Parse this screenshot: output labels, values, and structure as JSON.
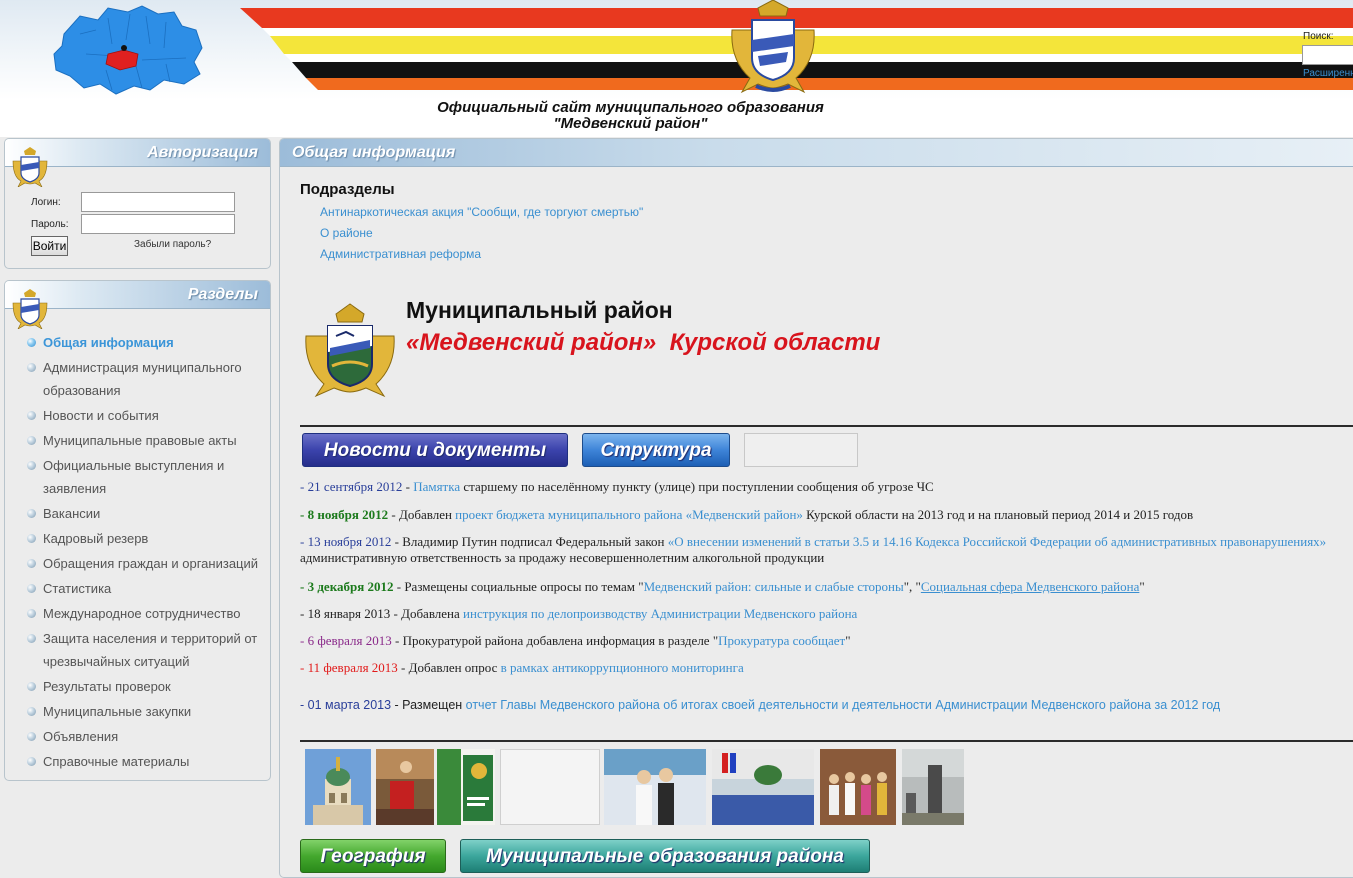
{
  "header": {
    "title_line1": "Официальный сайт муниципального образования",
    "title_line2": "\"Медвенский район\"",
    "search_label": "Поиск:",
    "search_value": "",
    "advanced_search_label": "Расширенный поиск",
    "flag_colors": [
      "#e8391f",
      "#f4e53a",
      "#111111",
      "#f06a1e"
    ]
  },
  "auth": {
    "title": "Авторизация",
    "login_label": "Логин:",
    "login_value": "",
    "password_label": "Пароль:",
    "password_value": "",
    "submit_label": "Войти",
    "forgot_label": "Забыли пароль?"
  },
  "sections": {
    "title": "Разделы",
    "items": [
      {
        "label": "Общая информация",
        "active": true
      },
      {
        "label": "Администрация муниципального образования"
      },
      {
        "label": "Новости и события"
      },
      {
        "label": "Муниципальные правовые акты"
      },
      {
        "label": "Официальные выступления и заявления"
      },
      {
        "label": "Вакансии"
      },
      {
        "label": "Кадровый резерв"
      },
      {
        "label": "Обращения граждан и организаций"
      },
      {
        "label": "Статистика"
      },
      {
        "label": "Международное сотрудничество"
      },
      {
        "label": "Защита населения и территорий от чрезвычайных ситуаций"
      },
      {
        "label": "Результаты проверок"
      },
      {
        "label": "Муниципальные закупки"
      },
      {
        "label": "Объявления"
      },
      {
        "label": "Справочные материалы"
      }
    ]
  },
  "main": {
    "title": "Общая информация",
    "subsections_title": "Подразделы",
    "subsections": [
      "Антинаркотическая акция \"Сообщи, где торгуют смертью\"",
      "О районе",
      "Административная реформа"
    ],
    "district_title": "Муниципальный район",
    "district_subtitle": "«Медвенский район»  Курской области",
    "tabs": {
      "news": "Новости и документы",
      "structure": "Структура"
    },
    "news": [
      {
        "date": "21 сентября 2012",
        "link": "Памятка",
        "text": " старшему по населённому пункту (улице) при поступлении сообщения об угрозе ЧС"
      },
      {
        "date": "8 ноября 2012",
        "text1": " Добавлен ",
        "link": "проект бюджета муниципального района «Медвенский район»",
        "text2": " Курской области  на 2013 год и на плановый период 2014 и 2015 годов"
      },
      {
        "date": "13 ноября 2012",
        "text1": " - Владимир Путин подписал Федеральный закон ",
        "link": "«О внесении изменений в статьи 3.5 и 14.16 Кодекса Российской Федерации об административных правонарушениях»",
        "line2": "административную ответственность за продажу    несовершеннолетним алкогольной продукции"
      },
      {
        "date": "3 декабря 2012",
        "text1": " - Размещены социальные опросы по темам \"",
        "link1": "Медвенский район: сильные и слабые стороны",
        "text2": "\", \"",
        "link2": "Социальная сфера Медвенского района",
        "text3": "\""
      },
      {
        "date": "18 января 2013",
        "text1": " - Добавлена ",
        "link": "инструкция по делопроизводству Администрации Медвенского района"
      },
      {
        "date": "6 февраля 2013",
        "text1": " - Прокуратурой района добавлена информация в разделе \"",
        "link": "Прокуратура сообщает",
        "text2": "\""
      },
      {
        "date": "11 февраля 2013",
        "text1": " - Добавлен опрос ",
        "link": "в рамках антикоррупционного мониторинга"
      },
      {
        "date": "01 марта 2013",
        "text1": " - Размещен ",
        "link": "отчет Главы Медвенского района об итогах своей деятельности и деятельности Администрации Медвенского района за 2012 год"
      }
    ],
    "thumbnail_icons": [
      "church-photo",
      "ceremony-photo",
      "booklet-photo",
      "blank-photo",
      "wedding-photo",
      "meeting-photo",
      "group-photo",
      "monument-photo"
    ],
    "bottom_tabs": {
      "geography": "География",
      "municipalities": "Муниципальные образования района"
    }
  }
}
